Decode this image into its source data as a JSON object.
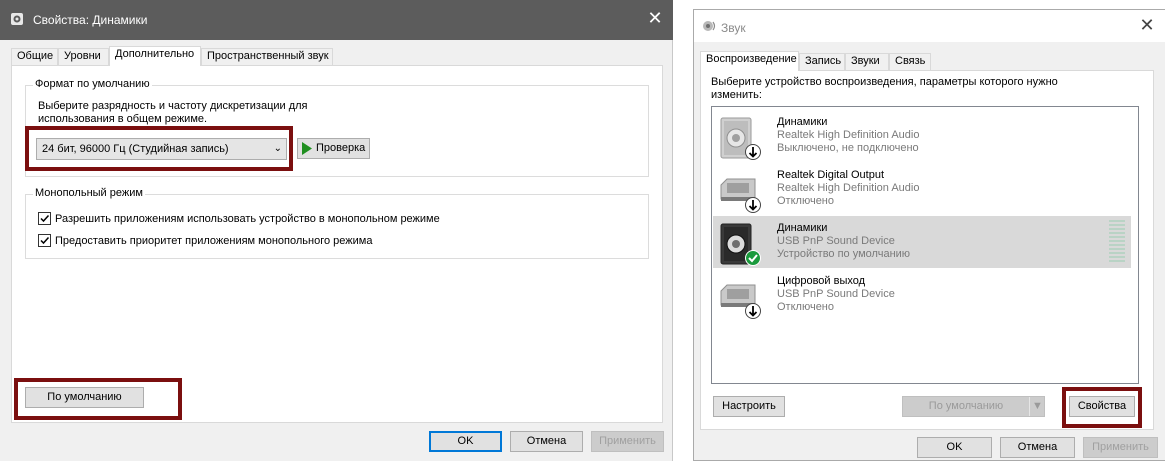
{
  "left_window": {
    "title": "Свойства: Динамики",
    "close_glyph": "✕",
    "tabs": [
      "Общие",
      "Уровни",
      "Дополнительно",
      "Пространственный звук"
    ],
    "active_tab": "Дополнительно",
    "default_format": {
      "legend": "Формат по умолчанию",
      "description": "Выберите разрядность и частоту дискретизации для использования в общем режиме.",
      "description_line1": "Выберите разрядность и частоту дискретизации для",
      "description_line2": "использования в общем режиме.",
      "selected_format": "24 бит, 96000 Гц (Студийная запись)",
      "test_button": "Проверка"
    },
    "exclusive_mode": {
      "legend": "Монопольный режим",
      "option1": {
        "label": "Разрешить приложениям использовать устройство в монопольном режиме",
        "checked": true
      },
      "option2": {
        "label": "Предоставить приоритет приложениям монопольного режима",
        "checked": true
      }
    },
    "restore_default_button": "По умолчанию",
    "ok_button": "OK",
    "cancel_button": "Отмена",
    "apply_button": "Применить"
  },
  "right_window": {
    "title": "Звук",
    "close_glyph": "✕",
    "tabs": [
      "Воспроизведение",
      "Запись",
      "Звуки",
      "Связь"
    ],
    "active_tab": "Воспроизведение",
    "instruction_line1": "Выберите устройство воспроизведения, параметры которого нужно",
    "instruction_line2": "изменить:",
    "devices": [
      {
        "name": "Динамики",
        "driver": "Realtek High Definition Audio",
        "status": "Выключено, не подключено",
        "icon": "speaker-icon",
        "badge": "down-arrow",
        "selected": false
      },
      {
        "name": "Realtek Digital Output",
        "driver": "Realtek High Definition Audio",
        "status": "Отключено",
        "icon": "digital-output-icon",
        "badge": "down-arrow",
        "selected": false
      },
      {
        "name": "Динамики",
        "driver": "USB PnP Sound Device",
        "status": "Устройство по умолчанию",
        "icon": "speaker-icon",
        "badge": "check",
        "selected": true
      },
      {
        "name": "Цифровой выход",
        "driver": "USB PnP Sound Device",
        "status": "Отключено",
        "icon": "digital-output-icon",
        "badge": "down-arrow",
        "selected": false
      }
    ],
    "configure_button": "Настроить",
    "set_default_button": "По умолчанию",
    "properties_button": "Свойства",
    "ok_button": "OK",
    "cancel_button": "Отмена",
    "apply_button": "Применить"
  },
  "colors": {
    "highlight_box": "#7b0f0f",
    "title_bar_dark": "#5c5c5c",
    "focus_blue": "#0078d7",
    "check_green": "#1a9a3c"
  }
}
